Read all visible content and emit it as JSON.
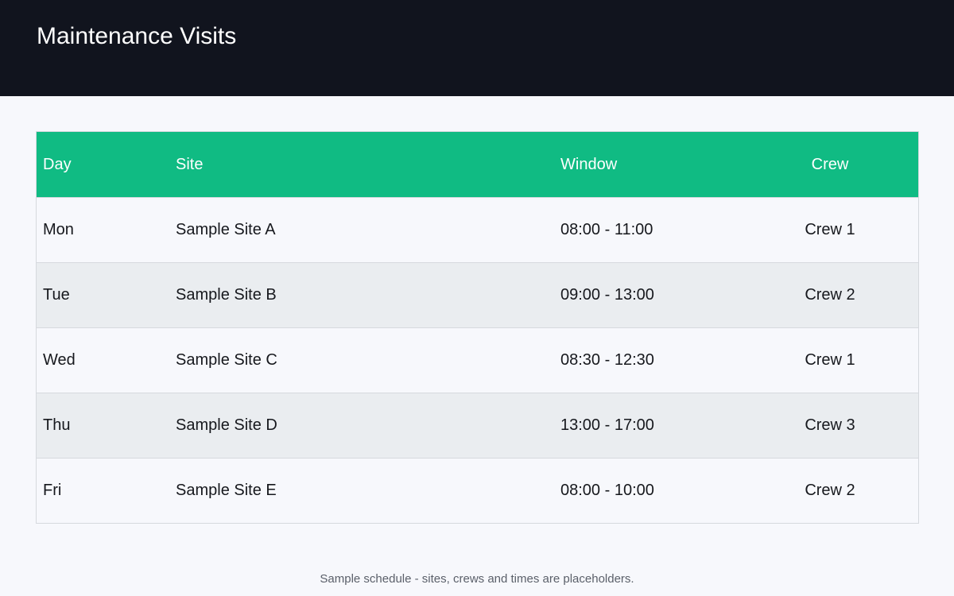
{
  "header": {
    "title": "Maintenance Visits"
  },
  "table": {
    "columns": [
      "Day",
      "Site",
      "Window",
      "Crew"
    ],
    "rows": [
      {
        "day": "Mon",
        "site": "Sample Site A",
        "window": "08:00 - 11:00",
        "crew": "Crew 1"
      },
      {
        "day": "Tue",
        "site": "Sample Site B",
        "window": "09:00 - 13:00",
        "crew": "Crew 2"
      },
      {
        "day": "Wed",
        "site": "Sample Site C",
        "window": "08:30 - 12:30",
        "crew": "Crew 1"
      },
      {
        "day": "Thu",
        "site": "Sample Site D",
        "window": "13:00 - 17:00",
        "crew": "Crew 3"
      },
      {
        "day": "Fri",
        "site": "Sample Site E",
        "window": "08:00 - 10:00",
        "crew": "Crew 2"
      }
    ]
  },
  "footer": {
    "note": "Sample schedule - sites, crews and times are placeholders."
  },
  "colors": {
    "header_bg": "#11141e",
    "accent": "#10bb83",
    "row_alt": "#eaedf0"
  }
}
